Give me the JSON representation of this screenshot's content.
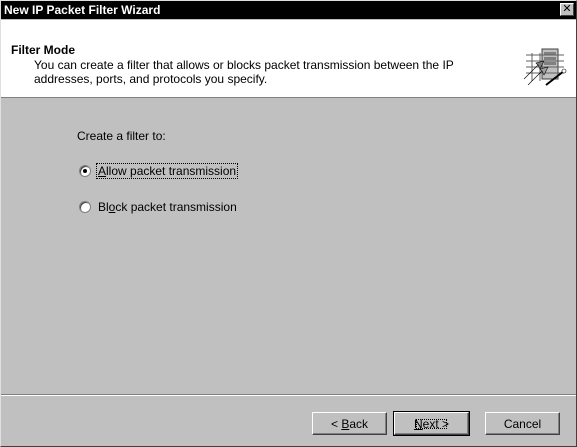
{
  "window": {
    "title": "New IP Packet Filter Wizard",
    "close_glyph": "✕"
  },
  "header": {
    "title": "Filter Mode",
    "description": "You can create a filter that allows or blocks packet transmission between the IP addresses, ports, and protocols you specify.",
    "icon": "wizard-banner-icon"
  },
  "content": {
    "prompt": "Create a filter to:",
    "options": [
      {
        "label_pre": "",
        "label_accel": "A",
        "label_post": "llow packet transmission",
        "selected": true
      },
      {
        "label_pre": "Bl",
        "label_accel": "o",
        "label_post": "ck packet transmission",
        "selected": false
      }
    ]
  },
  "buttons": {
    "back_pre": "< ",
    "back_accel": "B",
    "back_post": "ack",
    "next_pre": "",
    "next_accel": "N",
    "next_post": "ext >",
    "cancel": "Cancel"
  }
}
